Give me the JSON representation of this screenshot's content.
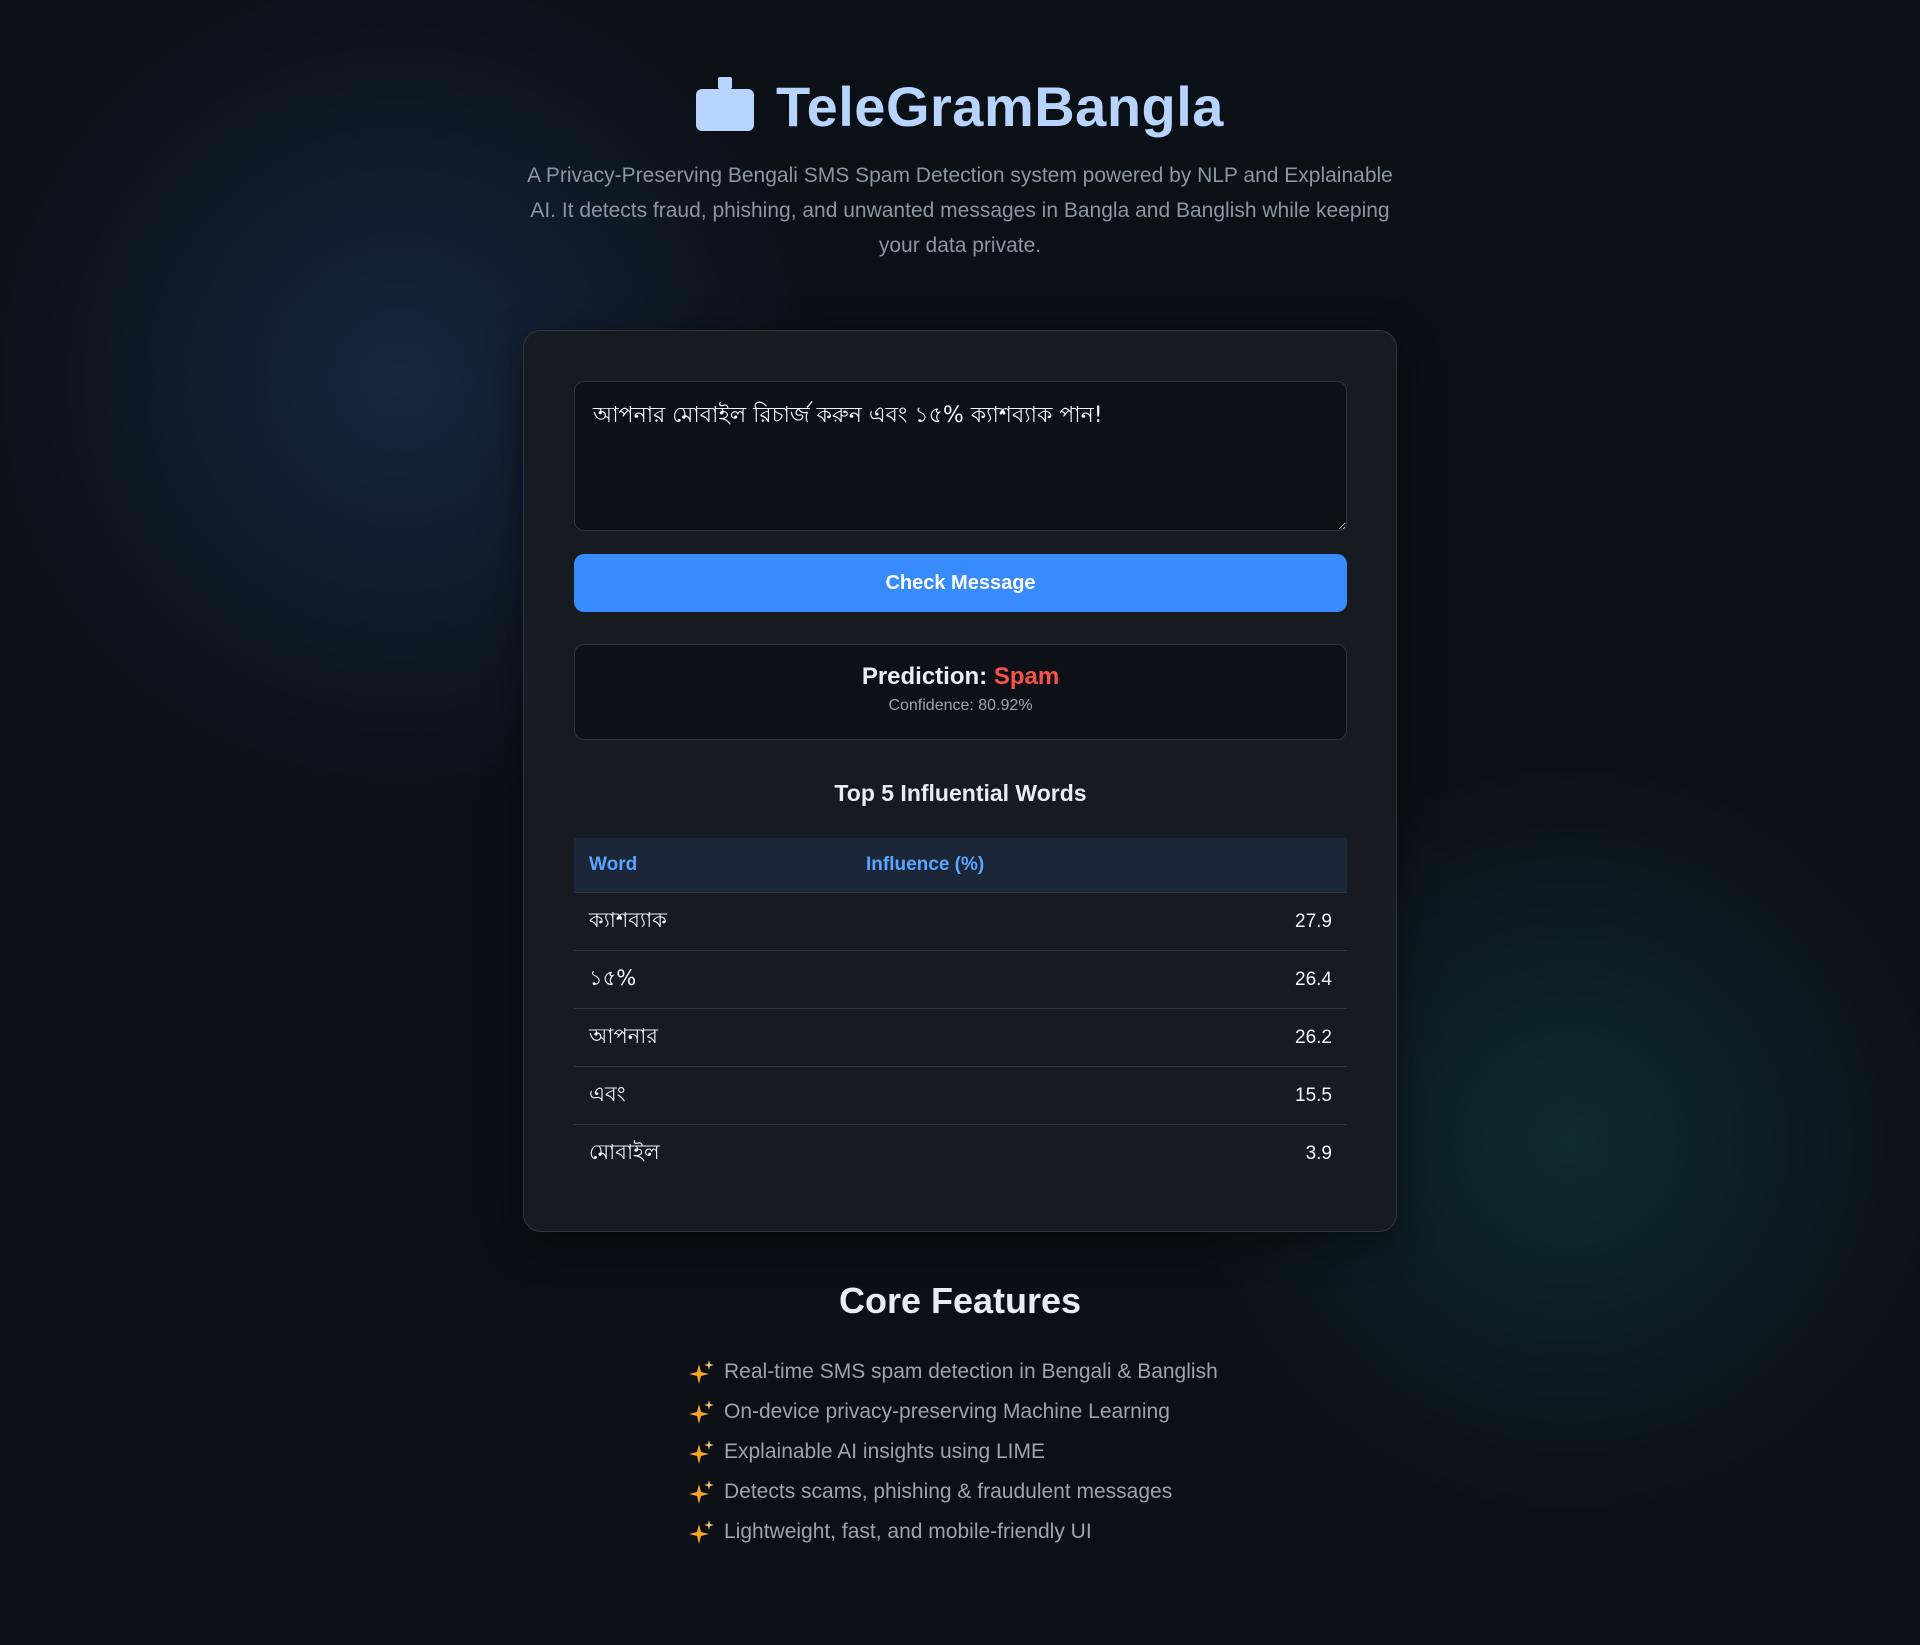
{
  "header": {
    "app_title": "TeleGramBangla",
    "logo_icon": "robot-icon",
    "subtitle": "A Privacy-Preserving Bengali SMS Spam Detection system powered by NLP and Explainable AI. It detects fraud, phishing, and unwanted messages in Bangla and Banglish while keeping your data private."
  },
  "checker": {
    "message_value": "আপনার মোবাইল রিচার্জ করুন এবং ১৫% ক্যাশব্যাক পান!",
    "button_label": "Check Message",
    "result": {
      "prediction_label": "Prediction:",
      "prediction_value": "Spam",
      "prediction_color": "#f85149",
      "confidence_text": "Confidence: 80.92%"
    },
    "influence_title": "Top 5 Influential Words",
    "table": {
      "headers": [
        "Word",
        "Influence (%)"
      ],
      "rows": [
        {
          "word": "ক্যাশব্যাক",
          "influence": "27.9"
        },
        {
          "word": "১৫%",
          "influence": "26.4"
        },
        {
          "word": "আপনার",
          "influence": "26.2"
        },
        {
          "word": "এবং",
          "influence": "15.5"
        },
        {
          "word": "মোবাইল",
          "influence": "3.9"
        }
      ]
    }
  },
  "features": {
    "title": "Core Features",
    "bullet_icon": "sparkles-icon",
    "items": [
      "Real-time SMS spam detection in Bengali & Banglish",
      "On-device privacy-preserving Machine Learning",
      "Explainable AI insights using LIME",
      "Detects scams, phishing & fraudulent messages",
      "Lightweight, fast, and mobile-friendly UI"
    ]
  },
  "colors": {
    "accent": "#388bfd",
    "title": "#b6d4fe",
    "spam": "#f85149",
    "table_header": "#58a6ff",
    "sparkle": "#f5a623"
  }
}
